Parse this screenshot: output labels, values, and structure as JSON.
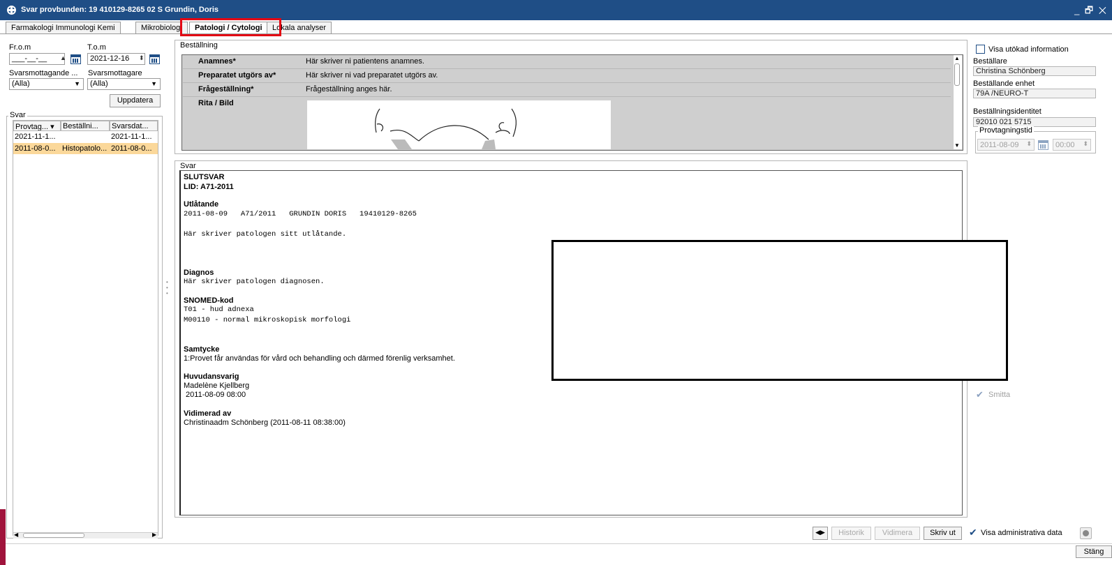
{
  "window": {
    "title": "Svar provbunden: 19 410129-8265 02 S Grundin, Doris",
    "controls": "_ 🗗 ✕"
  },
  "tabs": [
    {
      "label": "Farmakologi Immunologi Kemi"
    },
    {
      "label": "Mikrobiologi"
    },
    {
      "label": "Patologi / Cytologi"
    },
    {
      "label": "Lokala analyser"
    }
  ],
  "filters": {
    "from_label": "Fr.o.m",
    "to_label": "T.o.m",
    "from_value": "___-__-__",
    "to_value": "2021-12-16",
    "recipient1_label": "Svarsmottagande ...",
    "recipient2_label": "Svarsmottagare",
    "recipient1_value": "(Alla)",
    "recipient2_value": "(Alla)",
    "update_button": "Uppdatera"
  },
  "svar_list": {
    "legend": "Svar",
    "columns": [
      "Provtag...",
      "Beställni...",
      "Svarsdat..."
    ],
    "rows": [
      [
        "2021-11-1...",
        "",
        "2021-11-1..."
      ],
      [
        "2011-08-0...",
        "Histopatolo...",
        "2011-08-0..."
      ]
    ]
  },
  "order": {
    "legend": "Beställning",
    "rows": [
      {
        "key": "Anamnes*",
        "value": "Här skriver ni patientens anamnes."
      },
      {
        "key": "Preparatet utgörs av*",
        "value": "Här skriver ni vad preparatet utgörs av."
      },
      {
        "key": "Frågeställning*",
        "value": "Frågeställning anges här."
      },
      {
        "key": "Rita / Bild",
        "value": ""
      }
    ]
  },
  "answer": {
    "legend": "Svar",
    "final": "SLUTSVAR",
    "lid": "LID: A71-2011",
    "utlatande_h": "Utlåtande",
    "utlatande_line": "2011-08-09   A71/2011   GRUNDIN DORIS   19410129-8265",
    "utlatande_text": "Här skriver patologen sitt utlåtande.",
    "diagnos_h": "Diagnos",
    "diagnos_text": "Här skriver patologen diagnosen.",
    "snomed_h": "SNOMED-kod",
    "snomed_1": "T01 - hud adnexa",
    "snomed_2": "M00110 - normal mikroskopisk morfologi",
    "samtycke_h": "Samtycke",
    "samtycke_text": "1:Provet får användas för vård och behandling och därmed förenlig verksamhet.",
    "huvud_h": "Huvudansvarig",
    "huvud_name": "Madelène Kjellberg",
    "huvud_time": " 2011-08-09 08:00",
    "vid_h": "Vidimerad av",
    "vid_text": "Christinaadm Schönberg (2011-08-11 08:38:00)"
  },
  "right": {
    "show_extended": "Visa utökad information",
    "orderer_label": "Beställare",
    "orderer": "Christina Schönberg",
    "unit_label": "Beställande enhet",
    "unit": "79A /NEURO-T",
    "id_label": "Beställningsidentitet",
    "id": "92010 021 5715",
    "sampling_legend": "Provtagningstid",
    "sampling_date": "2011-08-09",
    "sampling_time": "00:00",
    "smitta": "Smitta"
  },
  "bottom": {
    "historik": "Historik",
    "vidimera": "Vidimera",
    "skriv_ut": "Skriv ut",
    "show_admin": "Visa administrativa data",
    "close": "Stäng"
  },
  "colors": {
    "titlebar": "#1f4e86",
    "highlight": "#e30613",
    "selected_row": "#fbd89a"
  }
}
